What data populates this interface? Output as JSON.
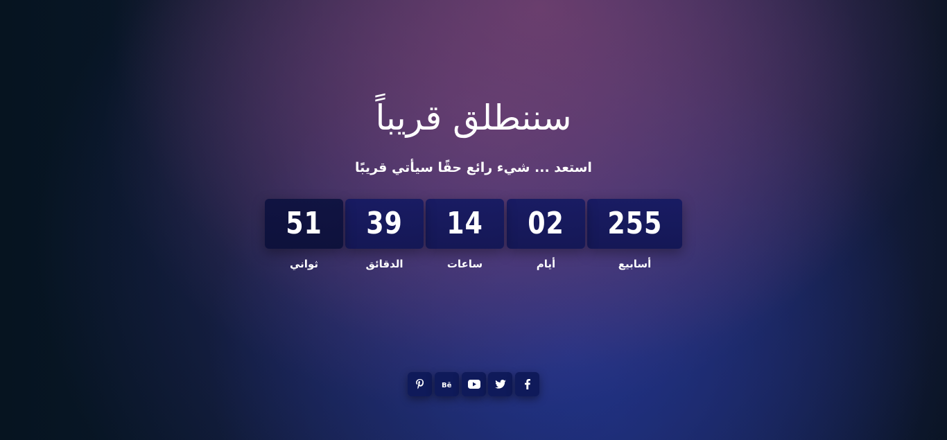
{
  "hero": {
    "title": "سننطلق قريباً",
    "subtitle": "استعد ... شيء رائع حقًا سيأتي قريبًا"
  },
  "countdown": {
    "weeks": {
      "value": "255",
      "label": "أسابيع"
    },
    "days": {
      "value": "02",
      "label": "أيام"
    },
    "hours": {
      "value": "14",
      "label": "ساعات"
    },
    "minutes": {
      "value": "39",
      "label": "الدقائق"
    },
    "seconds": {
      "value": "51",
      "label": "ثواني"
    }
  },
  "social": [
    {
      "icon": "pinterest-icon"
    },
    {
      "icon": "behance-icon"
    },
    {
      "icon": "youtube-icon"
    },
    {
      "icon": "twitter-icon"
    },
    {
      "icon": "facebook-icon"
    }
  ],
  "colors": {
    "box": "#161a62",
    "social_button": "#0f1a5a",
    "text": "#ffffff"
  }
}
